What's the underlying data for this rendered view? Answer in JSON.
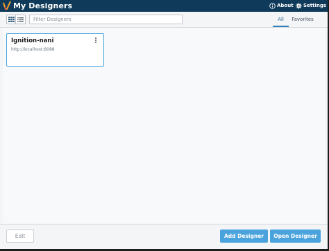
{
  "window": {
    "title": "My Designers",
    "about_label": "About",
    "settings_label": "Settings"
  },
  "toolbar": {
    "filter_placeholder": "Filter Designers",
    "filter_value": "",
    "tabs": [
      {
        "label": "All",
        "active": true
      },
      {
        "label": "Favorites",
        "active": false
      }
    ]
  },
  "designers": [
    {
      "name": "Ignition-nani",
      "url": "http://localhost:8088",
      "selected": true
    }
  ],
  "footer": {
    "edit_label": "Edit",
    "add_label": "Add Designer",
    "open_label": "Open Designer"
  },
  "colors": {
    "titlebar": "#0f3a5a",
    "accent": "#4aa3dc",
    "tab_active": "#2d7fb8"
  },
  "icons": [
    "app-logo-icon",
    "info-icon",
    "gear-icon",
    "grid-view-icon",
    "list-view-icon",
    "kebab-menu-icon"
  ]
}
